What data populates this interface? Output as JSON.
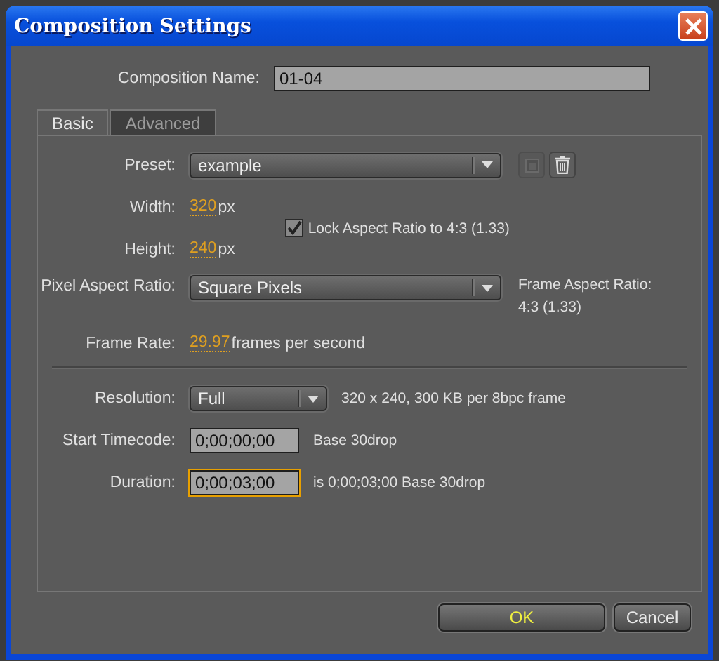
{
  "window": {
    "title": "Composition Settings"
  },
  "composition_name": {
    "label": "Composition Name:",
    "value": "01-04"
  },
  "tabs": [
    {
      "label": "Basic",
      "selected": true
    },
    {
      "label": "Advanced",
      "selected": false
    }
  ],
  "preset": {
    "label": "Preset:",
    "value": "example"
  },
  "width": {
    "label": "Width:",
    "value": "320",
    "unit": "px"
  },
  "lock_aspect": {
    "label": "Lock Aspect Ratio to 4:3 (1.33)",
    "checked": true
  },
  "height": {
    "label": "Height:",
    "value": "240",
    "unit": "px"
  },
  "pixel_aspect": {
    "label": "Pixel Aspect Ratio:",
    "value": "Square Pixels"
  },
  "frame_aspect": {
    "label": "Frame Aspect Ratio:",
    "value": "4:3 (1.33)"
  },
  "frame_rate": {
    "label": "Frame Rate:",
    "value": "29.97",
    "unit": "frames per second"
  },
  "resolution": {
    "label": "Resolution:",
    "value": "Full",
    "info": "320 x 240, 300 KB per 8bpc frame"
  },
  "start_timecode": {
    "label": "Start Timecode:",
    "value": "0;00;00;00",
    "info": "Base 30drop",
    "focused": false
  },
  "duration": {
    "label": "Duration:",
    "value": "0;00;03;00",
    "info": "is 0;00;03;00  Base 30drop",
    "focused": true
  },
  "buttons": [
    {
      "label": "OK",
      "kind": "ok"
    },
    {
      "label": "Cancel",
      "kind": "cancel"
    }
  ]
}
